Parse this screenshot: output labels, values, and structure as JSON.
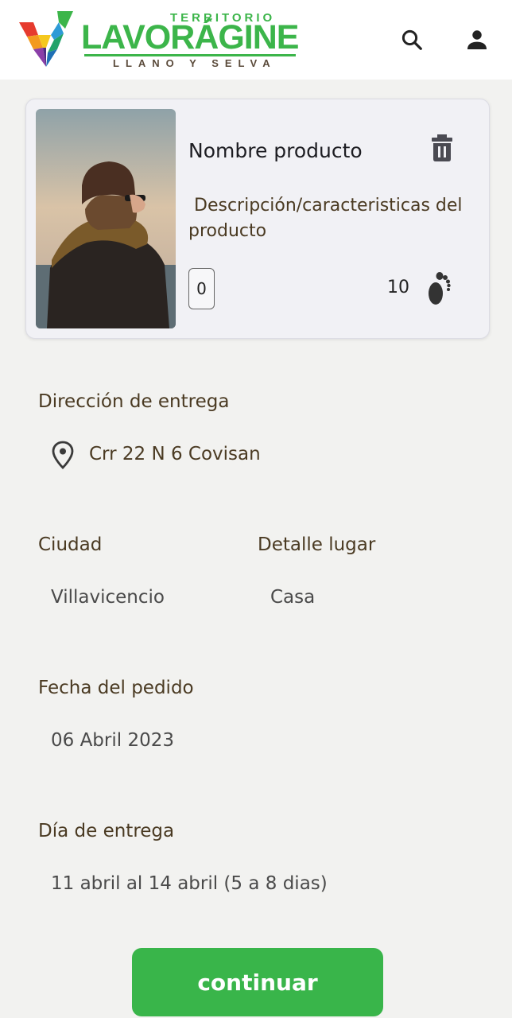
{
  "header": {
    "logo": {
      "top_text": "TERRITORIO",
      "main_text": "LAVORÁGINE",
      "sub_text": "LLANO Y SELVA"
    },
    "icons": [
      "search-icon",
      "user-icon"
    ]
  },
  "product": {
    "name": "Nombre producto",
    "description": " Descripción/caracteristicas del producto",
    "quantity": "0",
    "steps": "10",
    "icons": [
      "trash-icon",
      "footprint-icon"
    ]
  },
  "delivery": {
    "address_label": "Dirección de entrega",
    "address_value": "Crr 22 N 6 Covisan",
    "city_label": "Ciudad",
    "city_value": "Villavicencio",
    "place_label": "Detalle lugar",
    "place_value": "Casa",
    "order_date_label": "Fecha del pedido",
    "order_date_value": "06 Abril 2023",
    "delivery_day_label": "Día de entrega",
    "delivery_day_value": "11 abril al 14 abril (5 a 8 dias)"
  },
  "actions": {
    "continue_label": "continuar"
  },
  "colors": {
    "brand_green": "#39b54a",
    "label_brown": "#4a3a22",
    "background": "#f2f2f0"
  }
}
